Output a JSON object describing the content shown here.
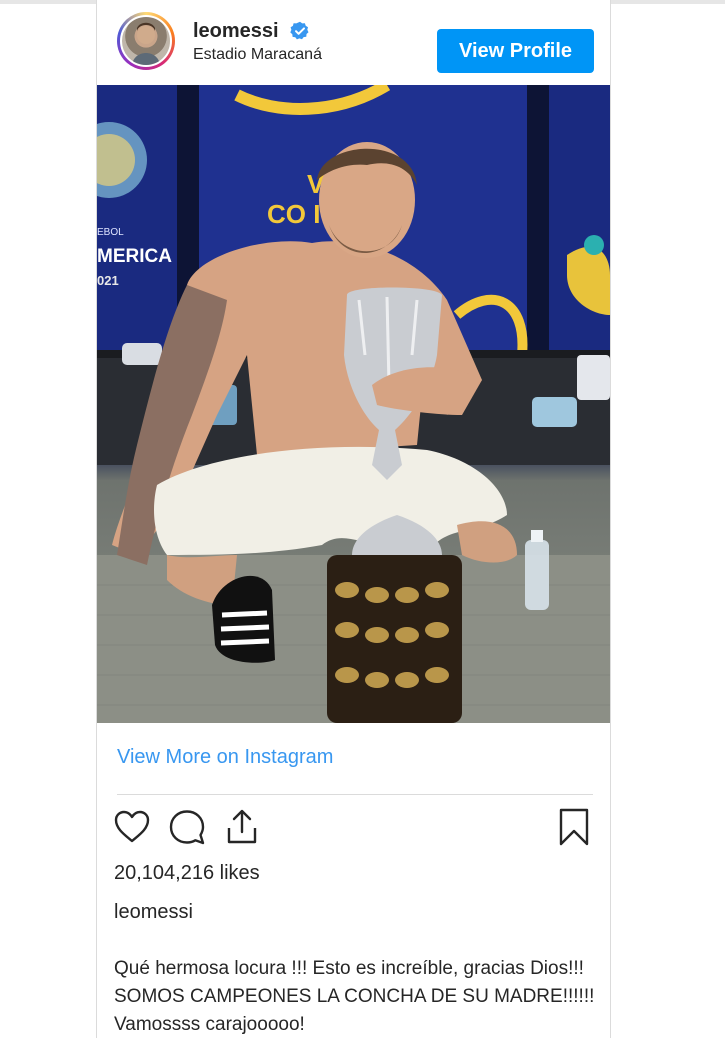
{
  "header": {
    "username": "leomessi",
    "location": "Estadio Maracaná",
    "view_profile_label": "View Profile"
  },
  "photo": {
    "banner_text_line1": "V  O",
    "banner_text_line2": "CO     ITE.",
    "left_banner_line1": "EBOL",
    "left_banner_line2": "MERICA",
    "left_banner_line3": "021"
  },
  "view_more_label": "View More on Instagram",
  "likes": "20,104,216 likes",
  "post_username": "leomessi",
  "caption": "Qué hermosa locura !!! Esto es increíble, gracias Dios!!! SOMOS CAMPEONES LA CONCHA DE SU MADRE!!!!!! Vamossss carajooooo!",
  "colors": {
    "accent": "#0095f6",
    "link": "#3897f0",
    "verified": "#3897f0"
  },
  "icons": [
    "heart-icon",
    "comment-icon",
    "share-icon",
    "bookmark-icon",
    "verified-badge-icon"
  ]
}
